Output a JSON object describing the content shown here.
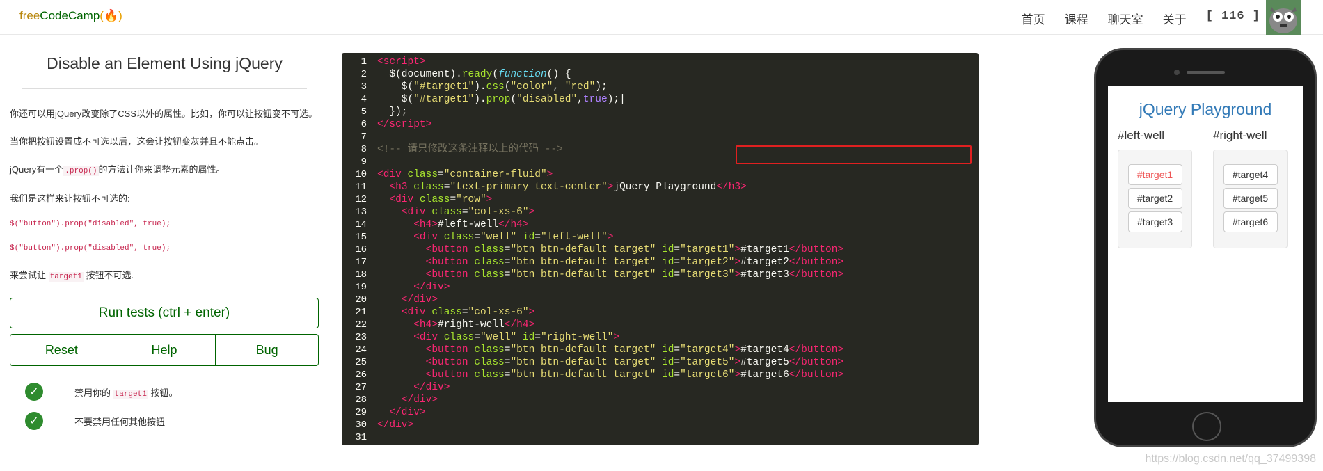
{
  "nav": {
    "brand_free": "free",
    "brand_rest": "CodeCamp",
    "brand_fire": "(🔥)",
    "links": [
      "首页",
      "课程",
      "聊天室",
      "关于"
    ],
    "points": "[ 116 ]"
  },
  "challenge": {
    "title": "Disable an Element Using jQuery",
    "p1": "你还可以用jQuery改变除了CSS以外的属性。比如，你可以让按钮变不可选。",
    "p2": "当你把按钮设置成不可选以后，这会让按钮变灰并且不能点击。",
    "p3_pre": "jQuery有一个",
    "p3_code": ".prop()",
    "p3_post": "的方法让你来调整元素的属性。",
    "p4": "我们是这样来让按钮不可选的:",
    "ex1": "$(\"button\").prop(\"disabled\", true);",
    "ex2": "$(\"button\").prop(\"disabled\", true);",
    "p5_pre": "来尝试让 ",
    "p5_code": "target1",
    "p5_post": " 按钮不可选."
  },
  "buttons": {
    "run": "Run tests (ctrl + enter)",
    "reset": "Reset",
    "help": "Help",
    "bug": "Bug"
  },
  "tests": [
    {
      "pre": "禁用你的 ",
      "code": "target1",
      "post": " 按钮。"
    },
    {
      "pre": "不要禁用任何其他按钮",
      "code": "",
      "post": ""
    }
  ],
  "editor": {
    "line_count": 31
  },
  "preview": {
    "title": "jQuery Playground",
    "left_heading": "#left-well",
    "right_heading": "#right-well",
    "left_buttons": [
      "#target1",
      "#target2",
      "#target3"
    ],
    "right_buttons": [
      "#target4",
      "#target5",
      "#target6"
    ]
  },
  "watermark": "https://blog.csdn.net/qq_37499398",
  "colors": {
    "brand_green": "#006400",
    "editor_bg": "#272822",
    "highlight_box": "#e02020",
    "preview_title": "#337ab7",
    "target1_text": "#e55555"
  }
}
